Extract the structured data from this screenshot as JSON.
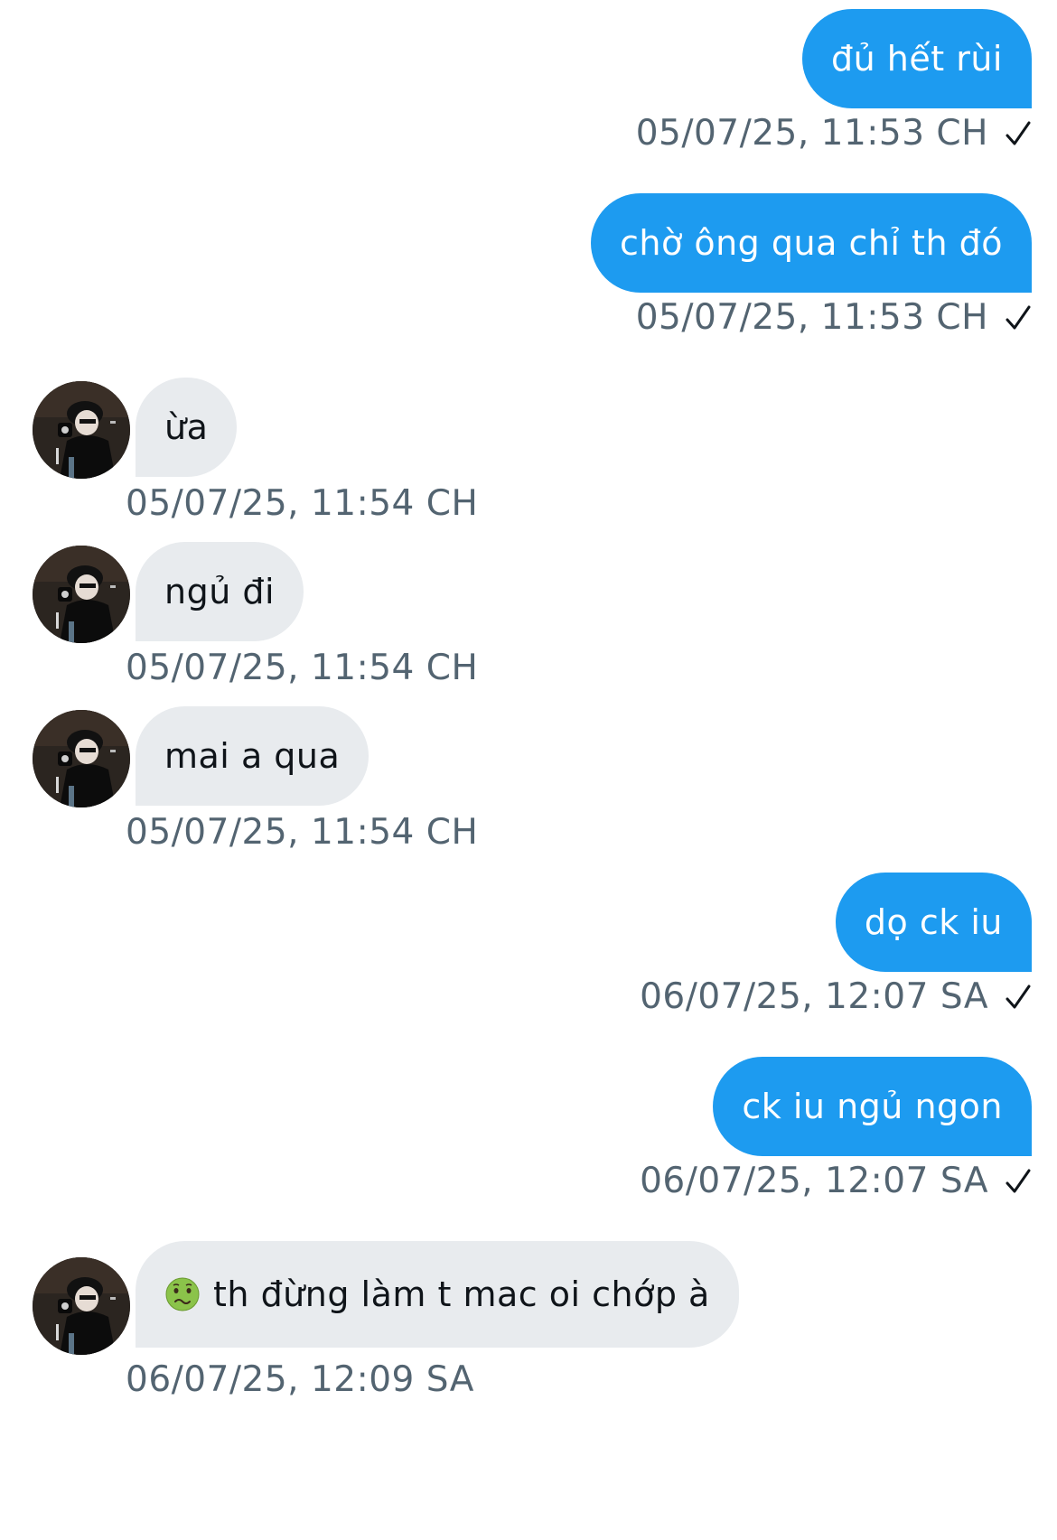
{
  "colors": {
    "outgoing_bubble": "#1d9bf0",
    "incoming_bubble": "#e8ebee",
    "timestamp": "#536471"
  },
  "messages": [
    {
      "direction": "out",
      "text": "đủ hết rùi",
      "time": "05/07/25, 11:53 CH",
      "status_icon": "check-icon"
    },
    {
      "direction": "out",
      "text": "chờ ông qua chỉ th đó",
      "time": "05/07/25, 11:53 CH",
      "status_icon": "check-icon"
    },
    {
      "direction": "in",
      "text": "ừa",
      "time": "05/07/25, 11:54 CH"
    },
    {
      "direction": "in",
      "text": "ngủ đi",
      "time": "05/07/25, 11:54 CH"
    },
    {
      "direction": "in",
      "text": "mai a qua",
      "time": "05/07/25, 11:54 CH"
    },
    {
      "direction": "out",
      "text": "dọ ck iu",
      "time": "06/07/25, 12:07 SA",
      "status_icon": "check-icon"
    },
    {
      "direction": "out",
      "text": "ck iu ngủ ngon",
      "time": "06/07/25, 12:07 SA",
      "status_icon": "check-icon"
    },
    {
      "direction": "in",
      "emoji": "nauseated-face-icon",
      "text": "th đừng làm t mac oi chớp à",
      "time": "06/07/25, 12:09 SA"
    }
  ]
}
